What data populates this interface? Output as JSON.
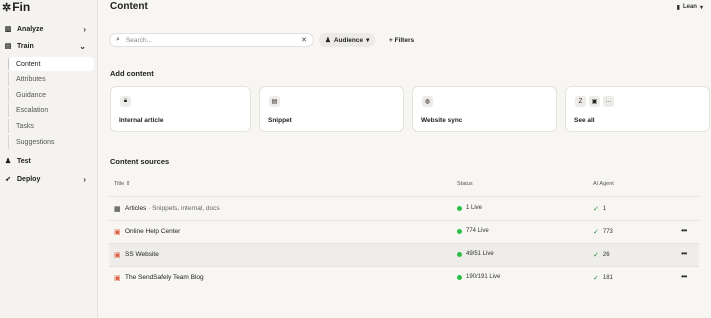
{
  "sidebar": {
    "logo": "Fin",
    "logo_mark": "✲",
    "nav": [
      {
        "label": "Analyze",
        "icon": "chart-icon"
      },
      {
        "label": "Train",
        "icon": "book-icon"
      },
      {
        "label": "Test",
        "icon": "person-icon"
      },
      {
        "label": "Deploy",
        "icon": "rocket-icon"
      }
    ],
    "train_items": [
      "Content",
      "Attributes",
      "Guidance",
      "Escalation",
      "Tasks",
      "Suggestions"
    ]
  },
  "header": {
    "title": "Content",
    "workspace": "Lean"
  },
  "toolbar": {
    "search_placeholder": "Search...",
    "audience_label": "Audience",
    "filters_label": "+ Filters"
  },
  "add_content": {
    "title": "Add content",
    "cards": [
      "Internal article",
      "Snippet",
      "Website sync",
      "See all"
    ]
  },
  "sources": {
    "title": "Content sources",
    "columns": {
      "title": "Title",
      "status": "Status",
      "agent": "AI Agent"
    },
    "rows": [
      {
        "icon": "library-icon",
        "name": "Articles",
        "sub": "· Snippets, internal, docs",
        "status": "1 Live",
        "agent": "1"
      },
      {
        "icon": "website-icon",
        "name": "Online Help Center",
        "sub": "",
        "status": "774 Live",
        "agent": "773"
      },
      {
        "icon": "website-icon",
        "name": "SS Website",
        "sub": "",
        "status": "49/51 Live",
        "agent": "26"
      },
      {
        "icon": "website-icon",
        "name": "The SendSafely Team Blog",
        "sub": "",
        "status": "190/191 Live",
        "agent": "181"
      }
    ]
  },
  "colors": {
    "live_dot": "#2bbf4a",
    "check": "#1b8a38",
    "accent_site": "#e05a3c"
  }
}
